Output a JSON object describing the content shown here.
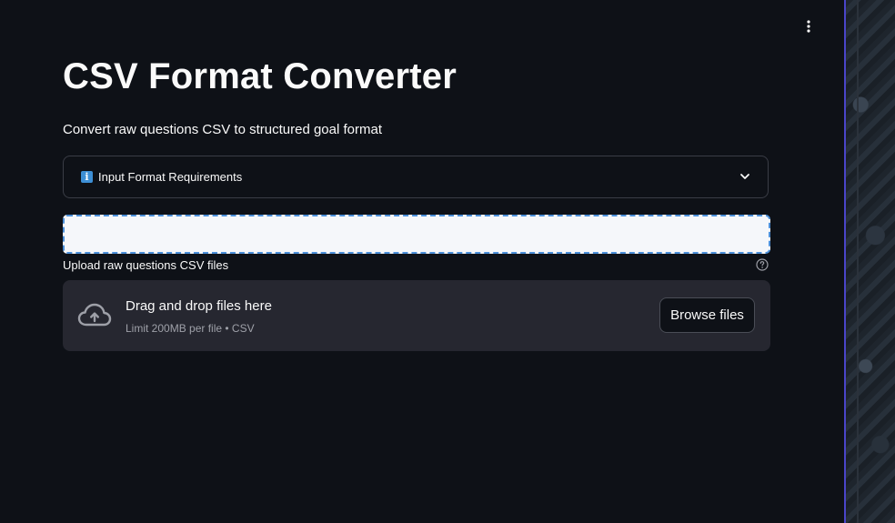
{
  "header": {
    "title": "CSV Format Converter",
    "subtitle": "Convert raw questions CSV to structured goal format"
  },
  "expander": {
    "label": "Input Format Requirements",
    "icon": "info-icon",
    "expanded": false
  },
  "uploader": {
    "label": "Upload raw questions CSV files",
    "dropzone_text": "Drag and drop files here",
    "limit_text": "Limit 200MB per file • CSV",
    "browse_label": "Browse files"
  },
  "colors": {
    "background": "#0e1117",
    "dropzone": "#262730",
    "accent": "#4b8fd9",
    "divider": "#4a45c9"
  }
}
